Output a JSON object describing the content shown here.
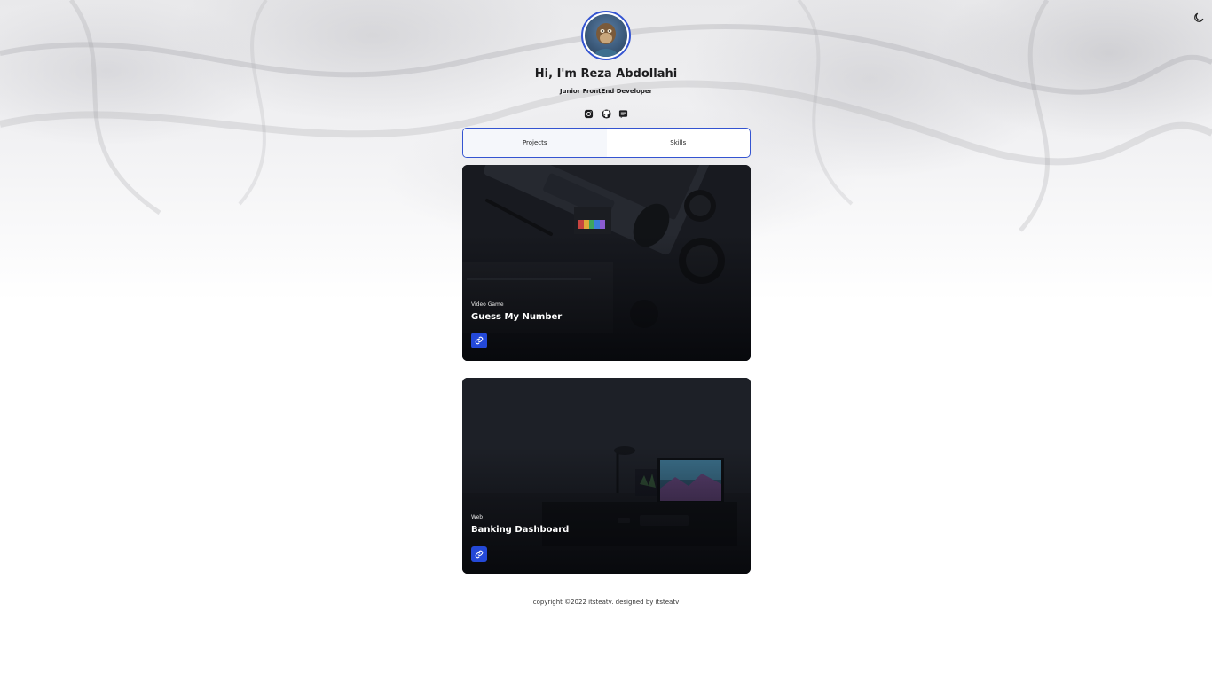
{
  "header": {
    "title": "Hi, I'm Reza Abdollahi",
    "subtitle": "Junior FrontEnd Developer",
    "avatar_icon": "ape-avatar-icon",
    "socials": [
      {
        "name": "instagram-icon"
      },
      {
        "name": "github-icon"
      },
      {
        "name": "discord-icon"
      }
    ]
  },
  "theme_toggle": {
    "icon": "moon-icon"
  },
  "tabs": [
    {
      "label": "Projects",
      "active": true
    },
    {
      "label": "Skills",
      "active": false
    }
  ],
  "projects": [
    {
      "category": "Video Game",
      "name": "Guess My Number",
      "link_icon": "link-icon"
    },
    {
      "category": "Web",
      "name": "Banking Dashboard",
      "link_icon": "link-icon"
    }
  ],
  "footer": {
    "text": "copyright ©2022 itsteatv. designed by itsteatv"
  },
  "colors": {
    "accent": "#3454d1",
    "button": "#2449d8",
    "card_bg": "#15171c"
  }
}
